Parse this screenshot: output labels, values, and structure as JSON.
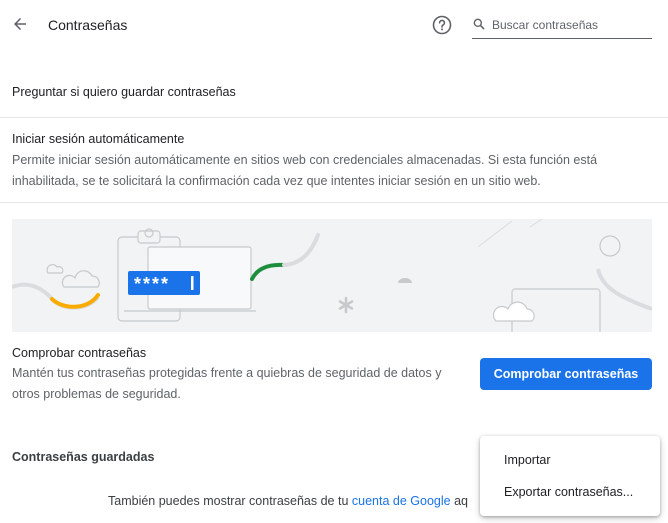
{
  "header": {
    "title": "Contraseñas",
    "search_placeholder": "Buscar contraseñas"
  },
  "settings": {
    "ask_to_save": "Preguntar si quiero guardar contraseñas",
    "auto_signin_title": "Iniciar sesión automáticamente",
    "auto_signin_desc": "Permite iniciar sesión automáticamente en sitios web con credenciales almacenadas. Si esta función está inhabilitada, se te solicitará la confirmación cada vez que intentes iniciar sesión en un sitio web."
  },
  "banner": {
    "password_mask": "****"
  },
  "check": {
    "title": "Comprobar contraseñas",
    "desc": "Mantén tus contraseñas protegidas frente a quiebras de seguridad de datos y otros problemas de seguridad.",
    "button": "Comprobar contraseñas"
  },
  "saved": {
    "title": "Contraseñas guardadas",
    "note_prefix": "También puedes mostrar contraseñas de tu ",
    "note_link": "cuenta de Google",
    "note_suffix": " aq"
  },
  "menu": {
    "items": [
      "Importar",
      "Exportar contraseñas..."
    ]
  },
  "colors": {
    "accent": "#1a73e8",
    "banner_bg": "#f1f3f4",
    "yellow": "#f9ab00",
    "green": "#1e8e3e"
  },
  "icons": {
    "back": "arrow-left-icon",
    "help": "help-circle-icon",
    "search": "search-icon"
  }
}
